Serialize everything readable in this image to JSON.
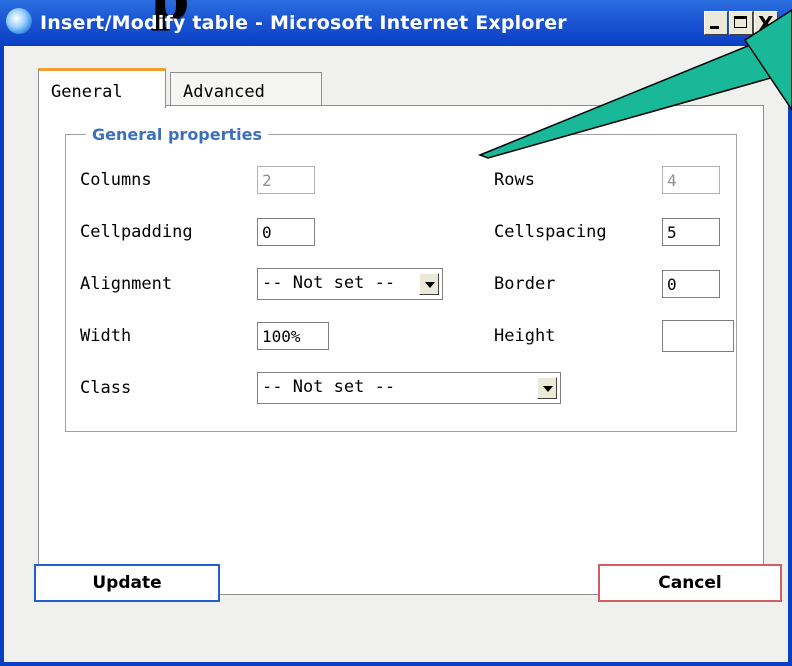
{
  "window": {
    "title": "Insert/Modify table - Microsoft Internet Explorer",
    "minimize": "_",
    "maximize": "□",
    "close": "X"
  },
  "tabs": [
    {
      "label": "General",
      "active": true
    },
    {
      "label": "Advanced",
      "active": false
    }
  ],
  "fieldset": {
    "legend": "General properties",
    "columns": {
      "label": "Columns",
      "value": "2"
    },
    "rows": {
      "label": "Rows",
      "value": "4"
    },
    "cellpadding": {
      "label": "Cellpadding",
      "value": "0"
    },
    "cellspacing": {
      "label": "Cellspacing",
      "value": "5"
    },
    "alignment": {
      "label": "Alignment",
      "value": "-- Not set --"
    },
    "border": {
      "label": "Border",
      "value": "0"
    },
    "width": {
      "label": "Width",
      "value": "100%"
    },
    "height": {
      "label": "Height",
      "value": ""
    },
    "class": {
      "label": "Class",
      "value": "-- Not set --"
    }
  },
  "buttons": {
    "update": "Update",
    "cancel": "Cancel"
  },
  "colors": {
    "titlebar": "#0a3fc4",
    "legend": "#3d6fc0",
    "callout": "#18b898",
    "tab_active_accent": "#f0a030"
  },
  "icons": [
    "ie-icon",
    "minimize-icon",
    "maximize-icon",
    "close-icon",
    "dropdown-arrow-icon"
  ]
}
